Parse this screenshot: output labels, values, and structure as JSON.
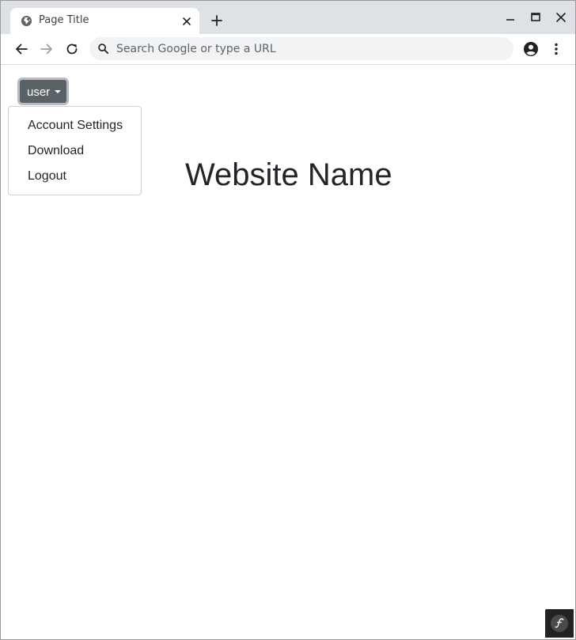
{
  "browser": {
    "tab": {
      "title": "Page Title",
      "favicon": "globe-icon",
      "close_icon": "close-icon"
    },
    "new_tab_icon": "plus-icon",
    "window_controls": [
      "minimize-icon",
      "maximize-icon",
      "close-icon"
    ],
    "toolbar": {
      "back_icon": "back-arrow-icon",
      "forward_icon": "forward-arrow-icon",
      "reload_icon": "reload-icon",
      "profile_icon": "account-circle-icon",
      "menu_icon": "kebab-menu-icon"
    },
    "omnibox": {
      "value": "",
      "placeholder": "Search Google or type a URL",
      "icon": "search-icon"
    }
  },
  "page": {
    "user_button": {
      "label": "user"
    },
    "dropdown": {
      "items": [
        "Account Settings",
        "Download",
        "Logout"
      ]
    },
    "site_title": "Website Name",
    "badge_icon": "symfony-toolbar-icon"
  },
  "colors": {
    "tabstrip_bg": "#dee1e6",
    "button_bg": "#5a6268",
    "text": "#212529",
    "badge_bg": "#222222"
  }
}
